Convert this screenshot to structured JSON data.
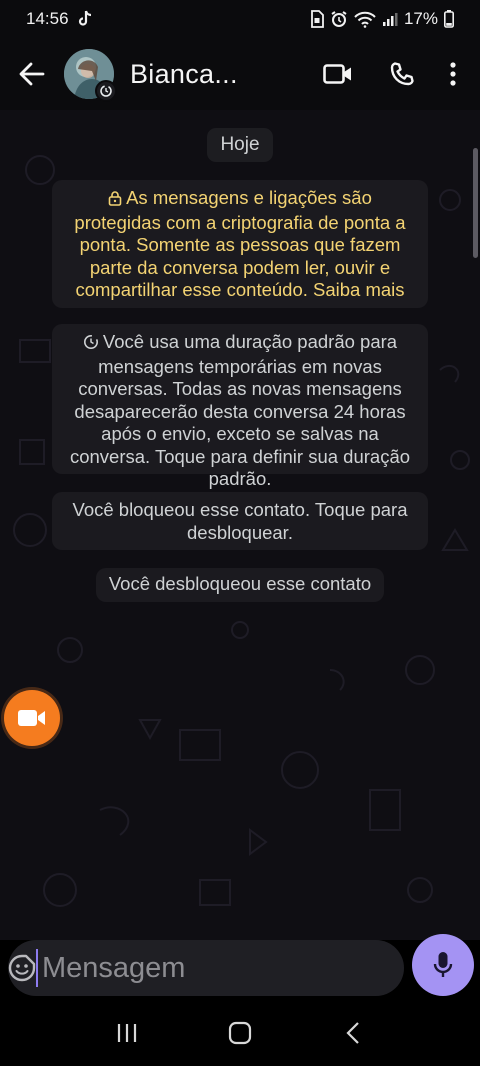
{
  "status_bar": {
    "time": "14:56",
    "battery": "17%"
  },
  "header": {
    "contact_name": "Bianca..."
  },
  "chat": {
    "date_label": "Hoje",
    "encryption_notice": "As mensagens e ligações são protegidas com a criptografia de ponta a ponta. Somente as pessoas que fazem parte da conversa podem ler, ouvir e compartilhar esse conteúdo. Saiba mais",
    "disappearing_notice": "Você usa uma duração padrão para mensagens temporárias em novas conversas. Todas as novas mensagens desaparecerão desta conversa 24 horas após o envio, exceto se salvas na conversa. Toque para definir sua duração padrão.",
    "blocked_notice": "Você bloqueou esse contato. Toque para desbloquear.",
    "unblocked_notice": "Você desbloqueou esse contato"
  },
  "composer": {
    "placeholder": "Mensagem"
  },
  "colors": {
    "accent": "#a493f3",
    "encryption_text": "#f3d373",
    "floating_button": "#f57c1f"
  },
  "icons": {
    "status_left": [
      "tiktok-icon"
    ],
    "status_right": [
      "sim-icon",
      "alarm-icon",
      "wifi-icon",
      "signal-icon",
      "battery-icon"
    ],
    "header": [
      "back-arrow-icon",
      "video-call-icon",
      "phone-icon",
      "more-vert-icon"
    ],
    "composer": [
      "sticker-icon",
      "attach-icon",
      "camera-icon",
      "mic-icon"
    ],
    "nav": [
      "recent-apps-icon",
      "home-icon",
      "back-icon"
    ]
  }
}
